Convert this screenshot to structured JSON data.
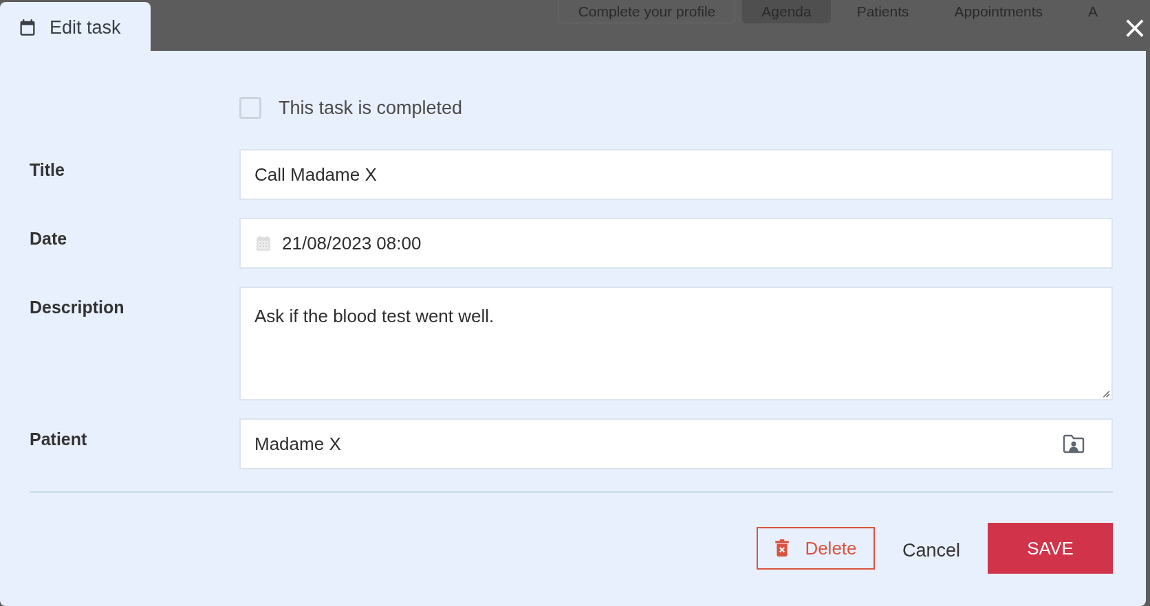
{
  "background_nav": [
    {
      "label": "Complete your profile",
      "selected": false
    },
    {
      "label": "Agenda",
      "selected": true
    },
    {
      "label": "Patients",
      "selected": false
    },
    {
      "label": "Appointments",
      "selected": false
    },
    {
      "label": "A",
      "selected": false
    }
  ],
  "dialog": {
    "tab_title": "Edit task",
    "close": "×"
  },
  "completed": {
    "label": "This task is completed",
    "checked": false
  },
  "fields": [
    {
      "kind": "text",
      "label": "Title",
      "value": "Call Madame X"
    },
    {
      "kind": "date",
      "label": "Date",
      "value": "21/08/2023 08:00"
    },
    {
      "kind": "textarea",
      "label": "Description",
      "value": "Ask if the blood test went well."
    },
    {
      "kind": "patient",
      "label": "Patient",
      "value": "Madame X"
    }
  ],
  "buttons": {
    "delete": "Delete",
    "cancel": "Cancel",
    "save": "SAVE"
  }
}
